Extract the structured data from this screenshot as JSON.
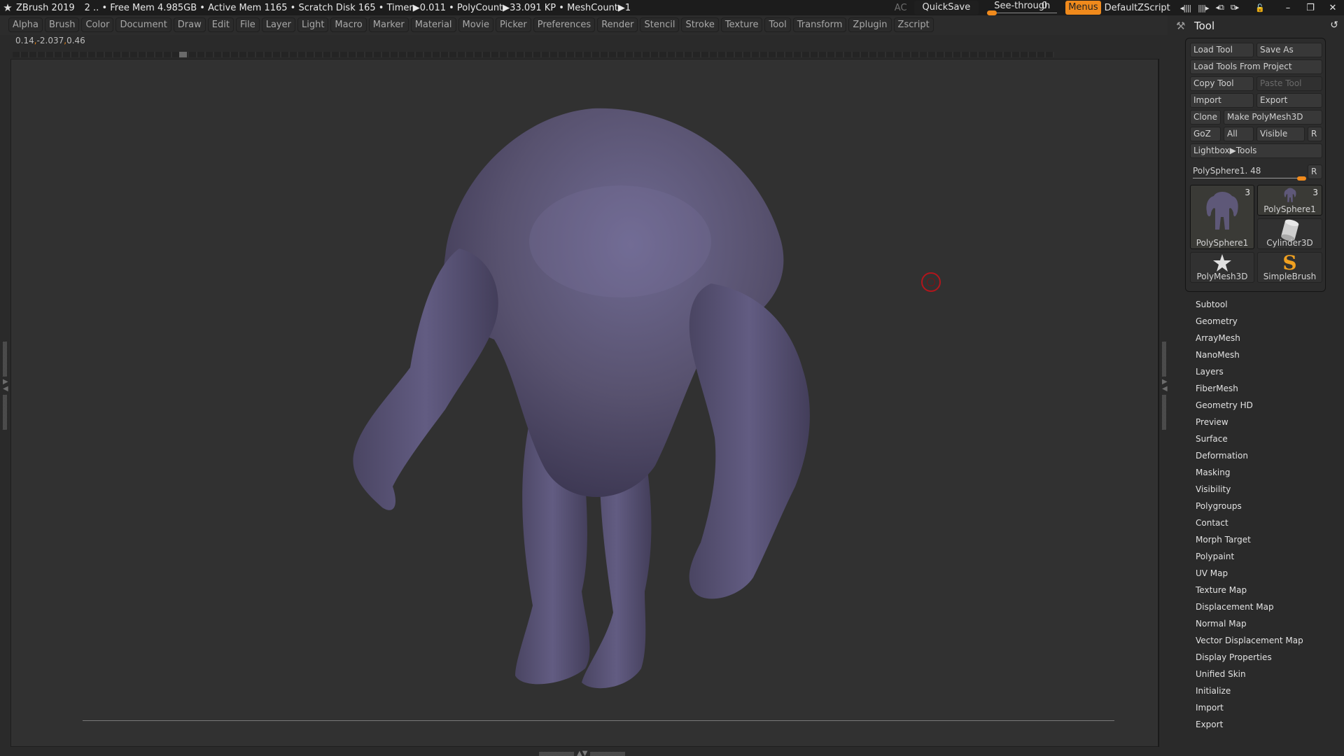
{
  "titlebar": {
    "app_name": "ZBrush 2019",
    "status": "2   .. • Free Mem 4.985GB • Active Mem 1165 • Scratch Disk 165 •  Timer▶0.011 • PolyCount▶33.091 KP  • MeshCount▶1",
    "ac_label": "AC",
    "quicksave_label": "QuickSave",
    "seethrough_label": "See-through",
    "seethrough_value": "0",
    "menus_label": "Menus",
    "script_label": "DefaultZScript",
    "icons": [
      "tray-left-icon",
      "tray-right-icon",
      "layout-prev-icon",
      "layout-next-icon",
      "lock-icon",
      "minimize-icon",
      "restore-icon",
      "close-icon"
    ]
  },
  "menubar": {
    "items": [
      "Alpha",
      "Brush",
      "Color",
      "Document",
      "Draw",
      "Edit",
      "File",
      "Layer",
      "Light",
      "Macro",
      "Marker",
      "Material",
      "Movie",
      "Picker",
      "Preferences",
      "Render",
      "Stencil",
      "Stroke",
      "Texture",
      "Tool",
      "Transform",
      "Zplugin",
      "Zscript"
    ]
  },
  "coords": {
    "x": "0.14",
    "y": "-2.037",
    "z": "0.46"
  },
  "timeline": {
    "position": 0.16
  },
  "canvas": {
    "model_color": "#5e5878",
    "cursor_color": "#b3151b"
  },
  "tool_panel": {
    "title": "Tool",
    "buttons": {
      "load_tool": "Load Tool",
      "save_as": "Save As",
      "load_from_project": "Load Tools From Project",
      "copy_tool": "Copy Tool",
      "paste_tool": "Paste Tool",
      "import": "Import",
      "export": "Export",
      "clone": "Clone",
      "make_polymesh": "Make PolyMesh3D",
      "goz": "GoZ",
      "all": "All",
      "visible": "Visible",
      "r": "R",
      "lightbox_tools": "Lightbox▶Tools"
    },
    "subtool_slider": {
      "label": "PolySphere1. 48",
      "r": "R",
      "value": 48
    },
    "thumbnails": [
      {
        "name": "PolySphere1",
        "count": "3",
        "selected": true
      },
      {
        "name": "PolySphere1",
        "count": "3",
        "selected": false
      },
      {
        "name": "Cylinder3D",
        "count": "",
        "selected": false
      },
      {
        "name": "PolyMesh3D",
        "count": "",
        "selected": false
      },
      {
        "name": "SimpleBrush",
        "count": "",
        "selected": false
      }
    ],
    "menu": [
      "Subtool",
      "Geometry",
      "ArrayMesh",
      "NanoMesh",
      "Layers",
      "FiberMesh",
      "Geometry HD",
      "Preview",
      "Surface",
      "Deformation",
      "Masking",
      "Visibility",
      "Polygroups",
      "Contact",
      "Morph Target",
      "Polypaint",
      "UV Map",
      "Texture Map",
      "Displacement Map",
      "Normal Map",
      "Vector Displacement Map",
      "Display Properties",
      "Unified Skin",
      "Initialize",
      "Import",
      "Export"
    ]
  }
}
